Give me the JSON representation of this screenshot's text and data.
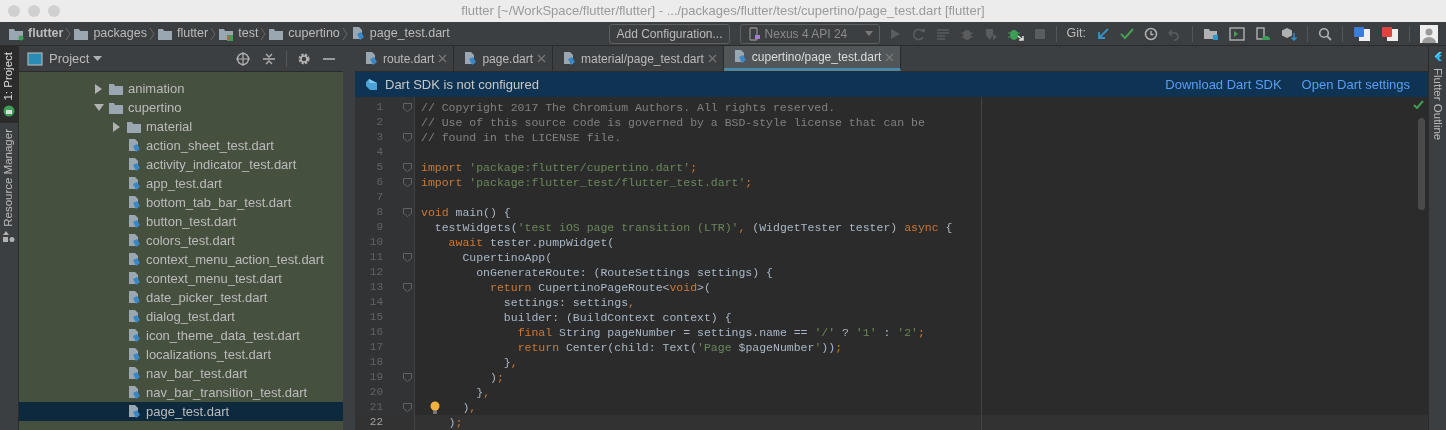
{
  "window": {
    "title": "flutter [~/WorkSpace/flutter/flutter] - .../packages/flutter/test/cupertino/page_test.dart [flutter]"
  },
  "breadcrumbs": [
    {
      "label": "flutter",
      "kind": "module"
    },
    {
      "label": "packages",
      "kind": "folder"
    },
    {
      "label": "flutter",
      "kind": "folder"
    },
    {
      "label": "test",
      "kind": "test_folder"
    },
    {
      "label": "cupertino",
      "kind": "folder"
    },
    {
      "label": "page_test.dart",
      "kind": "file"
    }
  ],
  "run_config_button": "Add Configuration...",
  "device_selector": {
    "label": "Nexus 4 API 24"
  },
  "git_label": "Git:",
  "left_tabs": [
    {
      "label": "1: Project",
      "selected": true
    },
    {
      "label": "Resource Manager",
      "selected": false
    }
  ],
  "project_panel": {
    "title": "Project",
    "tree": [
      {
        "label": "animation",
        "kind": "folder",
        "expanded": false,
        "selected": false
      },
      {
        "label": "cupertino",
        "kind": "folder",
        "expanded": true,
        "selected": false,
        "children": [
          {
            "label": "material",
            "kind": "folder",
            "expanded": false,
            "selected": false
          },
          {
            "label": "action_sheet_test.dart",
            "kind": "file",
            "selected": false
          },
          {
            "label": "activity_indicator_test.dart",
            "kind": "file",
            "selected": false
          },
          {
            "label": "app_test.dart",
            "kind": "file",
            "selected": false
          },
          {
            "label": "bottom_tab_bar_test.dart",
            "kind": "file",
            "selected": false
          },
          {
            "label": "button_test.dart",
            "kind": "file",
            "selected": false
          },
          {
            "label": "colors_test.dart",
            "kind": "file",
            "selected": false
          },
          {
            "label": "context_menu_action_test.dart",
            "kind": "file",
            "selected": false
          },
          {
            "label": "context_menu_test.dart",
            "kind": "file",
            "selected": false
          },
          {
            "label": "date_picker_test.dart",
            "kind": "file",
            "selected": false
          },
          {
            "label": "dialog_test.dart",
            "kind": "file",
            "selected": false
          },
          {
            "label": "icon_theme_data_test.dart",
            "kind": "file",
            "selected": false
          },
          {
            "label": "localizations_test.dart",
            "kind": "file",
            "selected": false
          },
          {
            "label": "nav_bar_test.dart",
            "kind": "file",
            "selected": false
          },
          {
            "label": "nav_bar_transition_test.dart",
            "kind": "file",
            "selected": false
          },
          {
            "label": "page_test.dart",
            "kind": "file",
            "selected": true
          }
        ]
      }
    ]
  },
  "editor_tabs": [
    {
      "label": "route.dart",
      "selected": false
    },
    {
      "label": "page.dart",
      "selected": false
    },
    {
      "label": "material/page_test.dart",
      "selected": false
    },
    {
      "label": "cupertino/page_test.dart",
      "selected": true
    }
  ],
  "banner": {
    "message": "Dart SDK is not configured",
    "actions": [
      "Download Dart SDK",
      "Open Dart settings"
    ]
  },
  "code": [
    {
      "number": "1",
      "current": false,
      "fold": true,
      "segments": [
        {
          "kind": "comment",
          "text": "// Copyright 2017 The Chromium Authors. All rights reserved."
        }
      ]
    },
    {
      "number": "2",
      "current": false,
      "fold": false,
      "segments": [
        {
          "kind": "comment",
          "text": "// Use of this source code is governed by a BSD-style license that can be"
        }
      ]
    },
    {
      "number": "3",
      "current": false,
      "fold": true,
      "segments": [
        {
          "kind": "comment",
          "text": "// found in the LICENSE file."
        }
      ]
    },
    {
      "number": "4",
      "current": false,
      "fold": false
    },
    {
      "number": "5",
      "current": false,
      "fold": true,
      "segments": [
        {
          "kind": "keyword",
          "text": "import "
        },
        {
          "kind": "string",
          "text": "'package:flutter/cupertino.dart'"
        },
        {
          "kind": "keyword",
          "text": ";"
        }
      ]
    },
    {
      "number": "6",
      "current": false,
      "fold": true,
      "segments": [
        {
          "kind": "keyword",
          "text": "import "
        },
        {
          "kind": "string",
          "text": "'package:flutter_test/flutter_test.dart'"
        },
        {
          "kind": "keyword",
          "text": ";"
        }
      ]
    },
    {
      "number": "7",
      "current": false,
      "fold": false
    },
    {
      "number": "8",
      "current": false,
      "fold": true,
      "segments": [
        {
          "kind": "keyword",
          "text": "void "
        },
        {
          "kind": "plain",
          "text": "main() {"
        }
      ]
    },
    {
      "number": "9",
      "current": false,
      "fold": false,
      "segments": [
        {
          "kind": "plain",
          "text": "  testWidgets("
        },
        {
          "kind": "string",
          "text": "'test iOS page transition (LTR)'"
        },
        {
          "kind": "keyword",
          "text": ", "
        },
        {
          "kind": "plain",
          "text": "(WidgetTester tester) "
        },
        {
          "kind": "keyword",
          "text": "async "
        },
        {
          "kind": "plain",
          "text": "{"
        }
      ]
    },
    {
      "number": "10",
      "current": false,
      "fold": false,
      "segments": [
        {
          "kind": "keyword",
          "text": "    await "
        },
        {
          "kind": "plain",
          "text": "tester.pumpWidget("
        }
      ]
    },
    {
      "number": "11",
      "current": false,
      "fold": true,
      "segments": [
        {
          "kind": "plain",
          "text": "      CupertinoApp("
        }
      ]
    },
    {
      "number": "12",
      "current": false,
      "fold": false,
      "segments": [
        {
          "kind": "plain",
          "text": "        onGenerateRoute: (RouteSettings settings) {"
        }
      ]
    },
    {
      "number": "13",
      "current": false,
      "fold": true,
      "segments": [
        {
          "kind": "keyword",
          "text": "          return "
        },
        {
          "kind": "plain",
          "text": "CupertinoPageRoute<"
        },
        {
          "kind": "keyword",
          "text": "void"
        },
        {
          "kind": "plain",
          "text": ">("
        }
      ]
    },
    {
      "number": "14",
      "current": false,
      "fold": false,
      "segments": [
        {
          "kind": "plain",
          "text": "            settings: settings"
        },
        {
          "kind": "keyword",
          "text": ","
        }
      ]
    },
    {
      "number": "15",
      "current": false,
      "fold": false,
      "segments": [
        {
          "kind": "plain",
          "text": "            builder: (BuildContext context) {"
        }
      ]
    },
    {
      "number": "16",
      "current": false,
      "fold": false,
      "segments": [
        {
          "kind": "keyword",
          "text": "              final "
        },
        {
          "kind": "plain",
          "text": "String pageNumber = settings.name == "
        },
        {
          "kind": "string",
          "text": "'/'"
        },
        {
          "kind": "plain",
          "text": " ? "
        },
        {
          "kind": "string",
          "text": "'1'"
        },
        {
          "kind": "plain",
          "text": " : "
        },
        {
          "kind": "string",
          "text": "'2'"
        },
        {
          "kind": "keyword",
          "text": ";"
        }
      ]
    },
    {
      "number": "17",
      "current": false,
      "fold": false,
      "segments": [
        {
          "kind": "keyword",
          "text": "              return "
        },
        {
          "kind": "plain",
          "text": "Center(child: Text("
        },
        {
          "kind": "string",
          "text": "'Page "
        },
        {
          "kind": "plain",
          "text": "$pageNumber"
        },
        {
          "kind": "string",
          "text": "'"
        },
        {
          "kind": "plain",
          "text": "))"
        },
        {
          "kind": "keyword",
          "text": ";"
        }
      ]
    },
    {
      "number": "18",
      "current": false,
      "fold": false,
      "segments": [
        {
          "kind": "plain",
          "text": "            }"
        },
        {
          "kind": "keyword",
          "text": ","
        }
      ]
    },
    {
      "number": "19",
      "current": false,
      "fold": true,
      "segments": [
        {
          "kind": "plain",
          "text": "          )"
        },
        {
          "kind": "keyword",
          "text": ";"
        }
      ]
    },
    {
      "number": "20",
      "current": false,
      "fold": false,
      "segments": [
        {
          "kind": "plain",
          "text": "        }"
        },
        {
          "kind": "keyword",
          "text": ","
        }
      ]
    },
    {
      "number": "21",
      "current": false,
      "fold": true,
      "bulb": true,
      "segments": [
        {
          "kind": "plain",
          "text": "      )"
        },
        {
          "kind": "keyword",
          "text": ","
        }
      ]
    },
    {
      "number": "22",
      "current": true,
      "fold": false,
      "segments": [
        {
          "kind": "plain",
          "text": "    )"
        },
        {
          "kind": "keyword",
          "text": ";"
        }
      ]
    }
  ],
  "right_tabs": [
    {
      "label": "Flutter Outline"
    }
  ]
}
